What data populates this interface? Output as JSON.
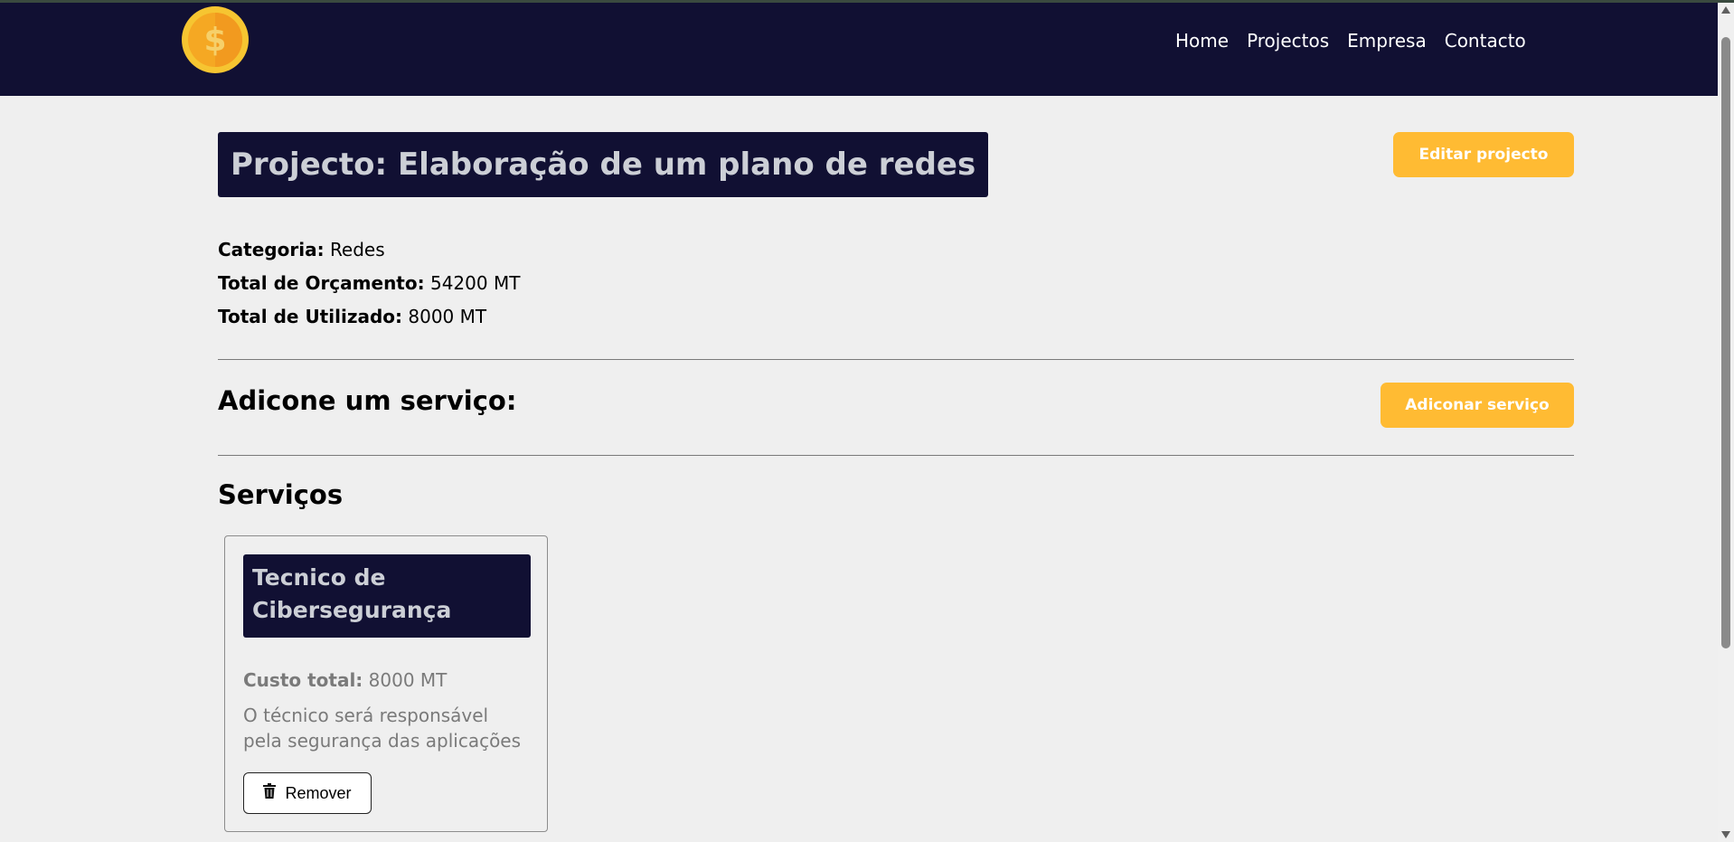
{
  "nav": {
    "links": [
      "Home",
      "Projectos",
      "Empresa",
      "Contacto"
    ]
  },
  "project": {
    "title": "Projecto: Elaboração de um plano de redes",
    "edit_label": "Editar projecto",
    "category_label": "Categoria:",
    "category_value": "Redes",
    "budget_label": "Total de Orçamento:",
    "budget_value": "54200 MT",
    "used_label": "Total de Utilizado:",
    "used_value": "8000 MT"
  },
  "add_service": {
    "heading": "Adicone um serviço:",
    "button_label": "Adiconar serviço"
  },
  "services": {
    "heading": "Serviços",
    "items": [
      {
        "title": "Tecnico de Cibersegurança",
        "cost_label": "Custo total:",
        "cost_value": "8000 MT",
        "description": "O técnico será responsável pela segurança das aplicações",
        "remove_label": "Remover"
      }
    ]
  },
  "colors": {
    "navbar": "#111033",
    "accent": "#ffbb33",
    "background": "#efefef"
  },
  "icons": {
    "logo": "coin-dollar-icon",
    "remove": "trash-icon"
  }
}
